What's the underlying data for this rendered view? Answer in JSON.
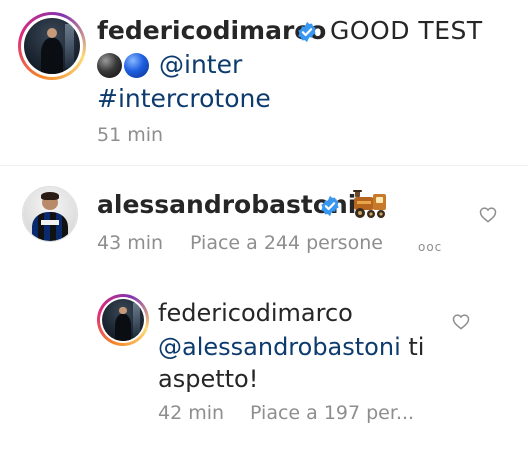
{
  "post": {
    "username": "federicodimarco",
    "text": "GOOD TEST",
    "mention": "@inter",
    "hashtag": "#intercrotone",
    "time": "51 min"
  },
  "comment": {
    "username": "alessandrobastoni",
    "time": "43 min",
    "likes": "Piace a 244 persone",
    "more": "ooc"
  },
  "reply": {
    "username": "federicodimarco",
    "mention": "@alessandrobastoni",
    "text_after_mention": " ti",
    "text_line2": "aspetto!",
    "time": "42 min",
    "likes": "Piace a 197 per..."
  },
  "icons": {
    "verified": "verified-badge-icon",
    "emoji_balls": "black-and-blue-circle-emoji",
    "emoji_train": "locomotive-emoji",
    "like": "heart-outline-icon"
  },
  "colors": {
    "verified": "#3897f0",
    "link": "#0d3b6e",
    "meta": "#8e8e8e"
  }
}
